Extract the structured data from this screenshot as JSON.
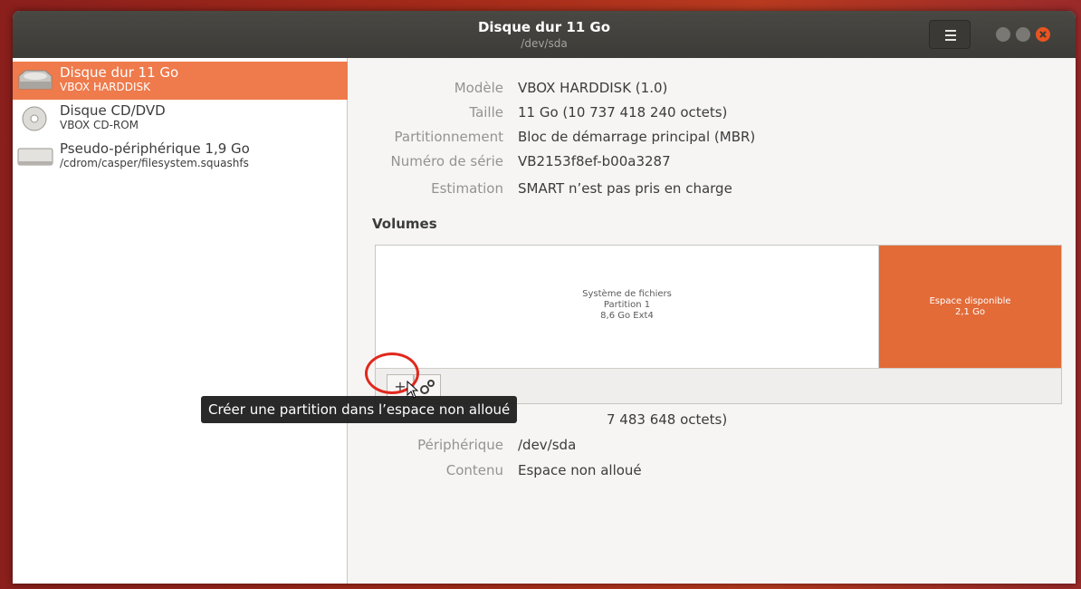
{
  "window": {
    "title": "Disque dur 11 Go",
    "subtitle": "/dev/sda"
  },
  "sidebar": {
    "items": [
      {
        "name": "Disque dur 11 Go",
        "sub": "VBOX HARDDISK",
        "icon": "hard-disk-icon",
        "selected": true
      },
      {
        "name": "Disque CD/DVD",
        "sub": "VBOX CD-ROM",
        "icon": "optical-disc-icon",
        "selected": false
      },
      {
        "name": "Pseudo-périphérique 1,9 Go",
        "sub": "/cdrom/casper/filesystem.squashfs",
        "icon": "loop-device-icon",
        "selected": false
      }
    ]
  },
  "properties": [
    {
      "label": "Modèle",
      "value": "VBOX HARDDISK (1.0)"
    },
    {
      "label": "Taille",
      "value": "11 Go (10 737 418 240 octets)"
    },
    {
      "label": "Partitionnement",
      "value": "Bloc de démarrage principal (MBR)"
    },
    {
      "label": "Numéro de série",
      "value": "VB2153f8ef-b00a3287"
    },
    {
      "label": "Estimation",
      "value": "SMART n’est pas pris en charge"
    }
  ],
  "volumes": {
    "heading": "Volumes",
    "partition": {
      "line1": "Système de fichiers",
      "line2": "Partition 1",
      "line3": "8,6 Go Ext4"
    },
    "free": {
      "line1": "Espace disponible",
      "line2": "2,1 Go"
    },
    "add_button": "+",
    "add_tooltip": "Créer une partition dans l’espace non alloué"
  },
  "selection_properties": {
    "size_tail": "7 483 648 octets)",
    "device_label": "Périphérique",
    "device_value": "/dev/sda",
    "content_label": "Contenu",
    "content_value": "Espace non alloué"
  },
  "colors": {
    "accent": "#e95420",
    "selection": "#ef7a4b",
    "free_space": "#e26b38",
    "titlebar": "#3c3b37"
  }
}
